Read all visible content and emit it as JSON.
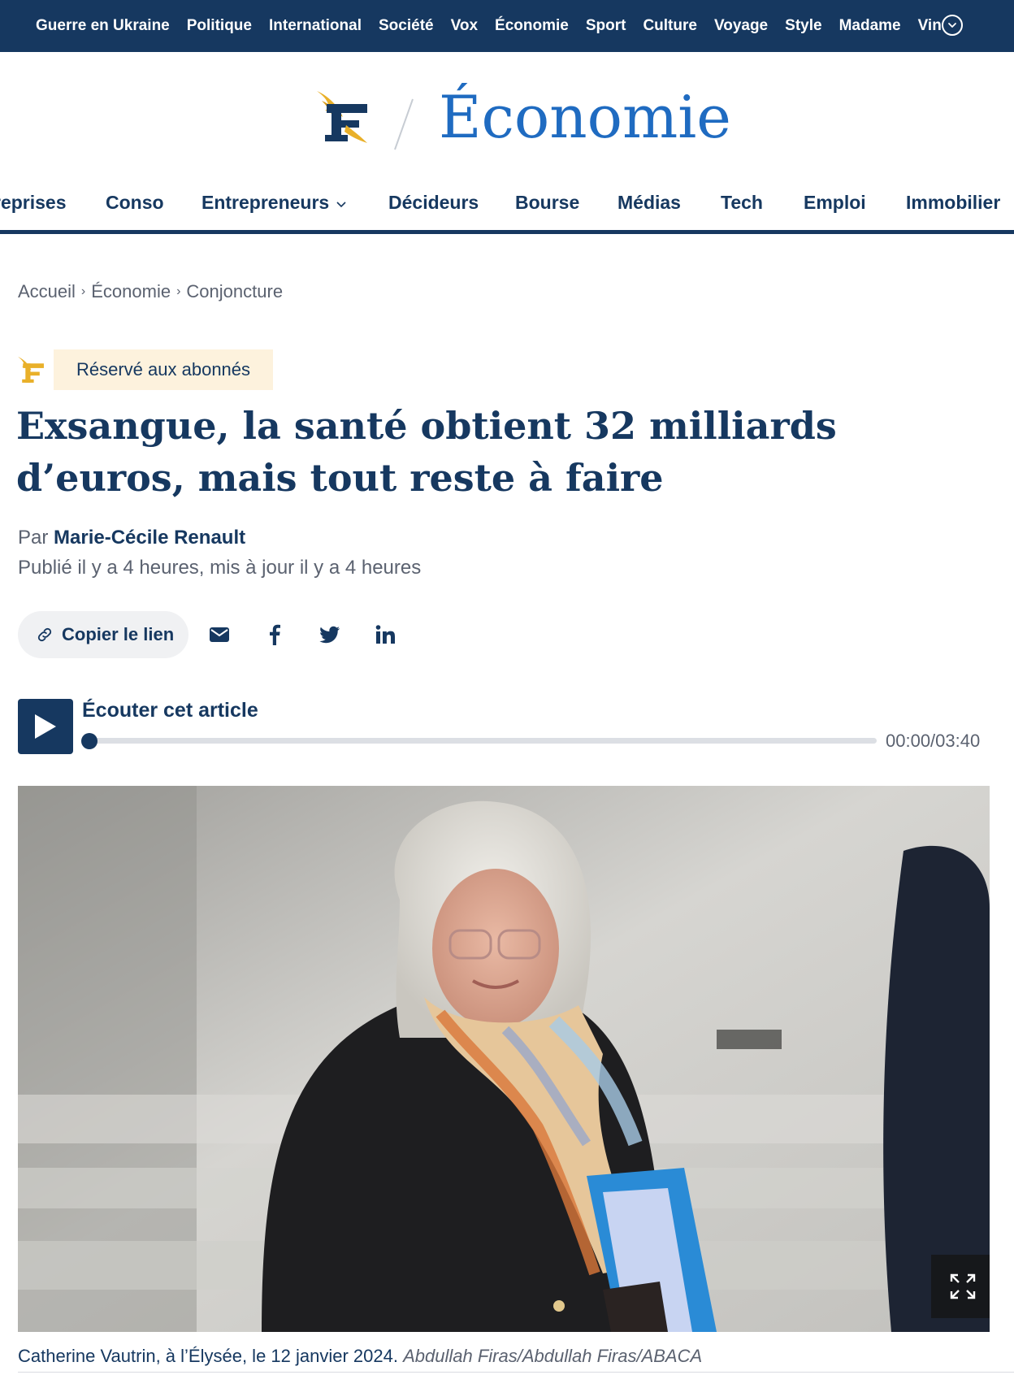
{
  "topnav": {
    "items": [
      "Guerre en Ukraine",
      "Politique",
      "International",
      "Société",
      "Vox",
      "Économie",
      "Sport",
      "Culture",
      "Voyage",
      "Style",
      "Madame",
      "Vin"
    ],
    "more_icon": "chevron-down-circle-icon"
  },
  "brand": {
    "logo_icon": "le-figaro-logo",
    "section": "Économie",
    "colors": {
      "navy": "#163860",
      "gold": "#e9b029",
      "section_blue": "#1f6bc1"
    }
  },
  "subnav": {
    "items": [
      "reprises",
      "Conso",
      "Entrepreneurs",
      "Décideurs",
      "Bourse",
      "Médias",
      "Tech",
      "Emploi",
      "Immobilier"
    ],
    "dropdown_icon": "chevron-down-icon"
  },
  "breadcrumb": [
    "Accueil",
    "Économie",
    "Conjoncture"
  ],
  "article": {
    "badge": "Réservé aux abonnés",
    "title": "Exsangue, la santé obtient 32 milliards d’euros, mais tout reste à faire",
    "by_prefix": "Par",
    "author": "Marie-Cécile Renault",
    "published": "Publié il y a 4 heures, mis à jour il y a 4 heures"
  },
  "share": {
    "copy_label": "Copier le lien",
    "icons": [
      "link-icon",
      "mail-icon",
      "facebook-icon",
      "twitter-icon",
      "linkedin-icon"
    ]
  },
  "audio": {
    "label": "Écouter cet article",
    "time": "00:00/03:40",
    "progress": 0
  },
  "photo": {
    "caption": "Catherine Vautrin, à l’Élysée, le 12 janvier 2024.",
    "credit": "Abdullah Firas/Abdullah Firas/ABACA",
    "expand_icon": "expand-icon"
  }
}
